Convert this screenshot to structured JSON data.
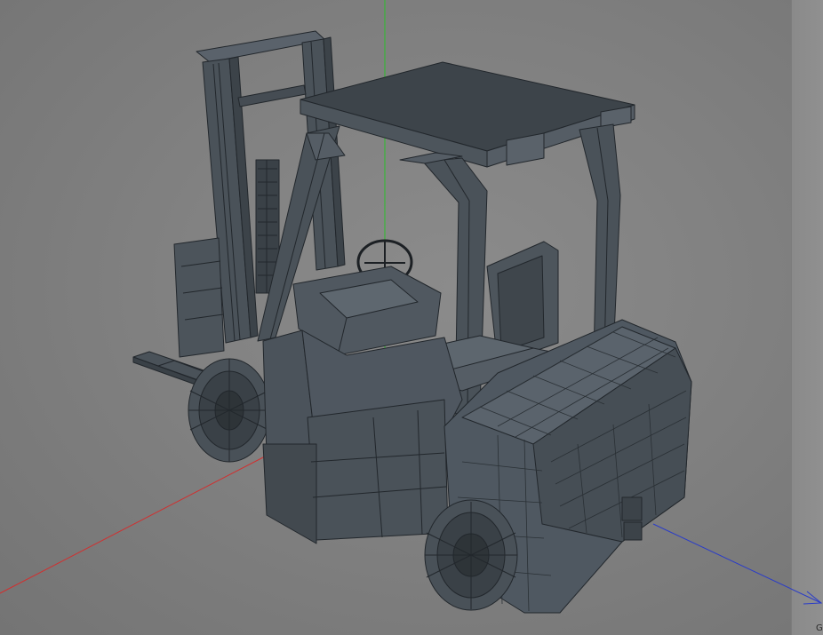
{
  "viewport": {
    "corner_label": "G",
    "axis_colors": {
      "x": "#d03030",
      "y": "#28c028",
      "z": "#2a3cc8"
    }
  },
  "model": {
    "icon": "forklift-model",
    "body_color": "#4b535b",
    "wire_color": "#22272c",
    "highlight_color": "#5c656e"
  }
}
